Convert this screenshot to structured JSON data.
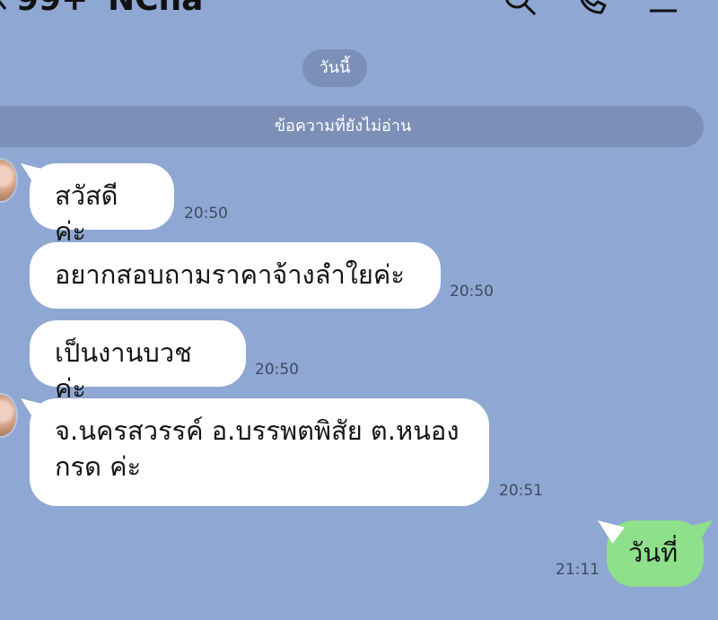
{
  "header": {
    "unread_count": "99+",
    "chat_name": "NCna",
    "icons": [
      "back-icon",
      "search-icon",
      "phone-icon",
      "menu-icon"
    ]
  },
  "date_label": "วันนี้",
  "unread_divider": "ข้อความที่ยังไม่อ่าน",
  "messages": [
    {
      "text": "สวัสดีค่ะ",
      "time": "20:50"
    },
    {
      "text": "อยากสอบถามราคาจ้างลำใยค่ะ",
      "time": "20:50"
    },
    {
      "text": "เป็นงานบวชค่ะ",
      "time": "20:50"
    },
    {
      "line1": "จ.นครสวรรค์ อ.บรรพตพิสัย ต.หนอง",
      "line2": "กรด ค่ะ",
      "time": "20:51"
    },
    {
      "text": "วันที่",
      "time": "21:11"
    }
  ],
  "colors": {
    "background": "#8fa7d3",
    "incoming_bubble": "#ffffff",
    "outgoing_bubble": "#8ee08b",
    "pill": "#7b8fb7"
  }
}
